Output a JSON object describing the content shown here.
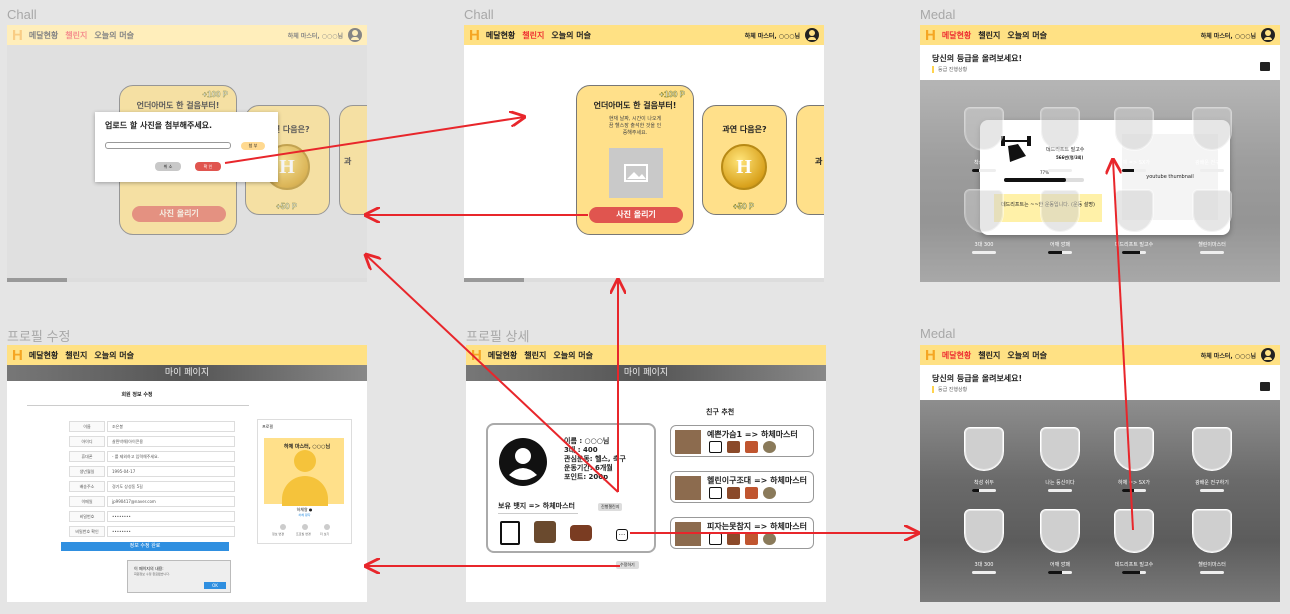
{
  "labels": {
    "f1": "Chall",
    "f2": "Chall",
    "f3": "Medal",
    "f4": "프로필 수정",
    "f5": "프로필 상세",
    "f6": "Medal"
  },
  "nav": {
    "logo": "H",
    "tab_medal": "메달현황",
    "tab_chall": "챌린지",
    "tab_today": "오늘의 머슬",
    "user": "하체 마스터, ○○○님"
  },
  "chall": {
    "card1_points": "+100 P",
    "card1_title": "언더아머도 한 걸음부터!",
    "card1_desc": "현재 날짜, 시간이 나오게끔 헬스장 출석한 것을 인증해주세요.",
    "card1_button": "사진 올리기",
    "card2_title": "과연 다음은?",
    "card2_points": "+50 P",
    "card3_title": "과",
    "coin_glyph": "H",
    "modal_title": "업로드 할 사진을 첨부해주세요.",
    "modal_attach": "첨 부",
    "modal_cancel": "취 소",
    "modal_confirm": "확 인"
  },
  "medal": {
    "heading": "당신의 등급을 올려보세요!",
    "subheading": "등급 진행상황",
    "items": [
      {
        "label": "착성 쉬두",
        "progress": 0.3
      },
      {
        "label": "나는 등신이다",
        "progress": 0.0
      },
      {
        "label": "하체 => SX가",
        "progress": 0.5
      },
      {
        "label": "광배운 전구하기",
        "progress": 0.0
      },
      {
        "label": "3대 300",
        "progress": 0.0
      },
      {
        "label": "어깨 깡패",
        "progress": 0.6
      },
      {
        "label": "데드리프트 빌고수",
        "progress": 0.77
      },
      {
        "label": "헬린이마스터",
        "progress": 0.0
      }
    ],
    "popup_name": "데드리프트 빌고수",
    "popup_progress_text": "566번(명/3회)",
    "popup_percent": "77%",
    "popup_note": "데드리프트는 ~~한 운동입니다. (운동 설명)",
    "popup_thumb": "youtube thumbnail"
  },
  "profile_edit": {
    "banner": "마이 페이지",
    "title": "회원 정보 수정",
    "rows": [
      {
        "k": "이름",
        "v": "조은봉"
      },
      {
        "k": "아이디",
        "v": "살찐박해(아이콘용"
      },
      {
        "k": "휴대폰",
        "v": "- 를 제외하고 입력해주세요."
      },
      {
        "k": "생년월일",
        "v": "1995-04-17"
      },
      {
        "k": "배송주소",
        "v": "경기도 상성동 5길"
      },
      {
        "k": "이메일",
        "v": "jp990417@naver.com"
      },
      {
        "k": "비밀번호",
        "v": "••••••••"
      },
      {
        "k": "비밀번호 확인",
        "v": "••••••••"
      }
    ],
    "submit": "정보 수정 완료",
    "side_title": "프로필",
    "side_name": "하체 마스터, ○○○님",
    "side_sub": "하체왕 ●",
    "side_sub2": "하체 왕자",
    "side_actions": [
      "정보 변경",
      "프로필 변경",
      "더 보기"
    ],
    "dialog_text": "이 페이지의 내용:",
    "dialog_sub": "회원정보 수정 완료됐습니다.",
    "dialog_ok": "OK"
  },
  "profile_detail": {
    "banner": "마이 페이지",
    "name": "이름 : ○○○님",
    "big3": "3대 : 400",
    "interest": "관심운동: 헬스, 축구",
    "period": "운동기간: 6개월",
    "points": "포인트: 200p",
    "badge_title": "보유 뱃지 => 하체마스터",
    "in_progress": "진행챌린지",
    "more": "...",
    "edit": "수정하기",
    "friends_title": "친구 추천",
    "friends": [
      {
        "name": "예쁜가슴1 => 하체마스터"
      },
      {
        "name": "헬린이구조대 => 하체마스터"
      },
      {
        "name": "피자는못참지 => 하체마스터"
      }
    ]
  }
}
